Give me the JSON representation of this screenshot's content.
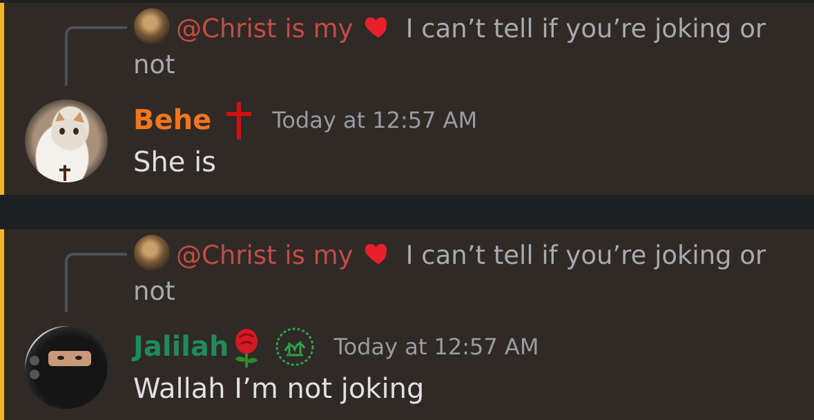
{
  "messages": [
    {
      "reply": {
        "mention": "@Christ is my",
        "heart_emoji": "❤️",
        "text": "I can’t tell if you’re joking or not"
      },
      "author": {
        "name": "Behe",
        "name_color": "#f2751f",
        "badge": "cross-icon"
      },
      "timestamp": "Today at 12:57 AM",
      "content": "She is"
    },
    {
      "reply": {
        "mention": "@Christ is my",
        "heart_emoji": "❤️",
        "text": "I can’t tell if you’re joking or not"
      },
      "author": {
        "name": "Jalilah",
        "name_color": "#1f8b5a",
        "badge": "rose-icon"
      },
      "timestamp": "Today at 12:57 AM",
      "content": "Wallah I’m not joking"
    }
  ],
  "colors": {
    "highlight_bar": "#f0b232",
    "message_bg": "#2f2a25",
    "separator_bg": "#1e1f22",
    "mention": "#c44b48"
  }
}
